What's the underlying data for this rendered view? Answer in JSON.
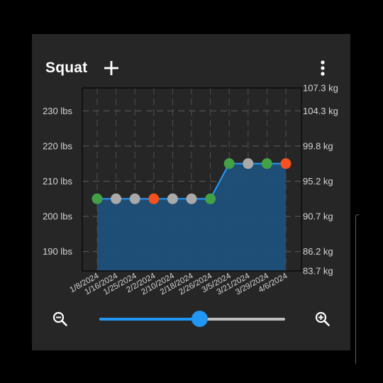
{
  "exercise": {
    "title": "Squat"
  },
  "toolbar": {
    "add_icon": "plus-icon",
    "menu_icon": "more-vert-icon"
  },
  "zoom": {
    "out_icon": "zoom-out-icon",
    "in_icon": "zoom-in-icon",
    "level": 0.54
  },
  "colors": {
    "line": "#2196f3",
    "area_fill": "#1d4f7a",
    "point_green": "#43a047",
    "point_gray": "#a9a9a9",
    "point_red": "#f4511e",
    "slider_active": "#2196f3",
    "slider_inactive": "#bdbdbd"
  },
  "chart_data": {
    "type": "area",
    "x_tick_labels": [
      "1/8/2024",
      "1/16/2024",
      "1/25/2024",
      "2/2/2024",
      "2/10/2024",
      "2/18/2024",
      "2/26/2024",
      "3/5/2024",
      "3/21/2024",
      "3/29/2024",
      "4/6/2024"
    ],
    "y_left": {
      "ticks": [
        190,
        200,
        210,
        220,
        230
      ],
      "tick_labels": [
        "190 lbs",
        "200 lbs",
        "210 lbs",
        "220 lbs",
        "230 lbs"
      ],
      "range": [
        184.5,
        236.5
      ]
    },
    "y_right": {
      "tick_labels": [
        "83.7 kg",
        "86.2 kg",
        "90.7 kg",
        "95.2 kg",
        "99.8 kg",
        "104.3 kg",
        "107.3 kg"
      ],
      "tick_values_lbs": [
        184.5,
        190,
        200,
        210,
        220,
        230,
        236.5
      ]
    },
    "grid": true,
    "series": [
      {
        "x": [
          "1/8/2024",
          "1/16/2024",
          "1/25/2024",
          "2/2/2024",
          "2/10/2024",
          "2/18/2024",
          "2/26/2024",
          "3/5/2024",
          "3/21/2024",
          "3/29/2024",
          "4/6/2024"
        ],
        "values": [
          205,
          205,
          205,
          205,
          205,
          205,
          205,
          215,
          215,
          215,
          215
        ],
        "point_status": [
          "green",
          "gray",
          "gray",
          "red",
          "gray",
          "gray",
          "green",
          "green",
          "gray",
          "green",
          "red"
        ]
      }
    ]
  }
}
